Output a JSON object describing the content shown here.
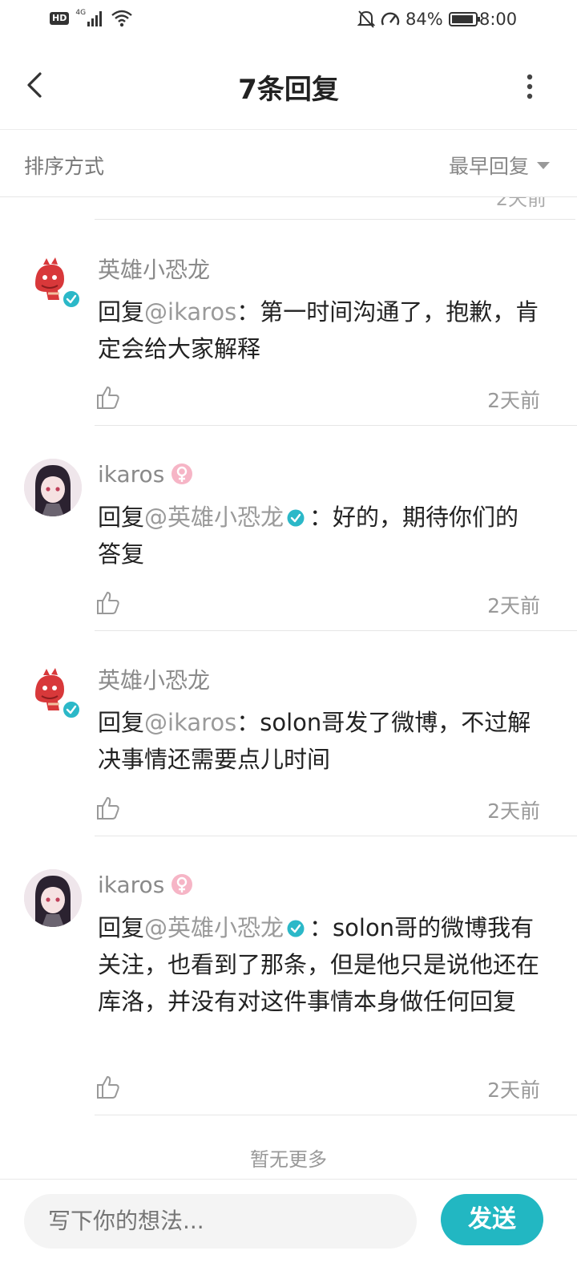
{
  "status_bar": {
    "hd": "HD",
    "network": "4G",
    "battery_percent": "84%",
    "time": "8:00"
  },
  "header": {
    "title": "7条回复"
  },
  "sort": {
    "label": "排序方式",
    "selected": "最早回复"
  },
  "partial_row": {
    "time": "2天前"
  },
  "replies": [
    {
      "author": "英雄小恐龙",
      "verified": true,
      "reply_prefix": "回复",
      "reply_to": "@ikaros",
      "reply_to_verified": false,
      "content": "：第一时间沟通了，抱歉，肯定会给大家解释",
      "time": "2天前"
    },
    {
      "author": "ikaros",
      "verified": false,
      "reply_prefix": "回复",
      "reply_to": "@英雄小恐龙",
      "reply_to_verified": true,
      "content": "：好的，期待你们的答复",
      "time": "2天前"
    },
    {
      "author": "英雄小恐龙",
      "verified": true,
      "reply_prefix": "回复",
      "reply_to": "@ikaros",
      "reply_to_verified": false,
      "content": "：solon哥发了微博，不过解决事情还需要点儿时间",
      "time": "2天前"
    },
    {
      "author": "ikaros",
      "verified": false,
      "reply_prefix": "回复",
      "reply_to": "@英雄小恐龙",
      "reply_to_verified": true,
      "content": "：solon哥的微博我有关注，也看到了那条，但是他只是说他还在库洛，并没有对这件事情本身做任何回复",
      "time": "2天前"
    }
  ],
  "no_more": "暂无更多",
  "composer": {
    "placeholder": "写下你的想法...",
    "send_label": "发送"
  },
  "colors": {
    "accent": "#22b7c2",
    "verified_badge": "#2bb8c8",
    "gender_badge": "#f0a8bc"
  }
}
